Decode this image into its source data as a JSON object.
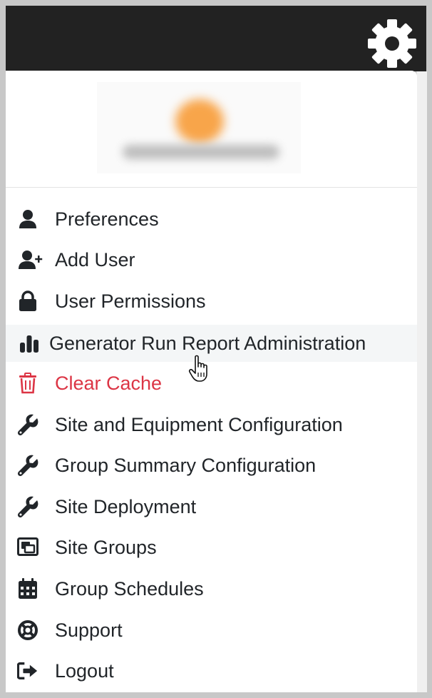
{
  "menu": {
    "items": [
      {
        "label": "Preferences",
        "icon": "user-icon"
      },
      {
        "label": "Add User",
        "icon": "user-plus-icon"
      },
      {
        "label": "User Permissions",
        "icon": "lock-icon"
      },
      {
        "label": "Generator Run Report Administration",
        "icon": "bar-chart-icon",
        "state": "hover"
      },
      {
        "label": "Clear Cache",
        "icon": "trash-icon",
        "color": "#dc3545"
      },
      {
        "label": "Site and Equipment Configuration",
        "icon": "wrench-icon"
      },
      {
        "label": "Group Summary Configuration",
        "icon": "wrench-icon"
      },
      {
        "label": "Site Deployment",
        "icon": "wrench-icon"
      },
      {
        "label": "Site Groups",
        "icon": "images-icon"
      },
      {
        "label": "Group Schedules",
        "icon": "calendar-icon"
      },
      {
        "label": "Support",
        "icon": "lifebuoy-icon"
      },
      {
        "label": "Logout",
        "icon": "logout-icon"
      }
    ]
  },
  "header": {
    "settings_icon": "gear-icon"
  },
  "colors": {
    "header_bg": "#222222",
    "text": "#212529",
    "danger": "#dc3545",
    "hover_bg": "#f4f6f7",
    "avatar_accent": "#f8a54a"
  }
}
